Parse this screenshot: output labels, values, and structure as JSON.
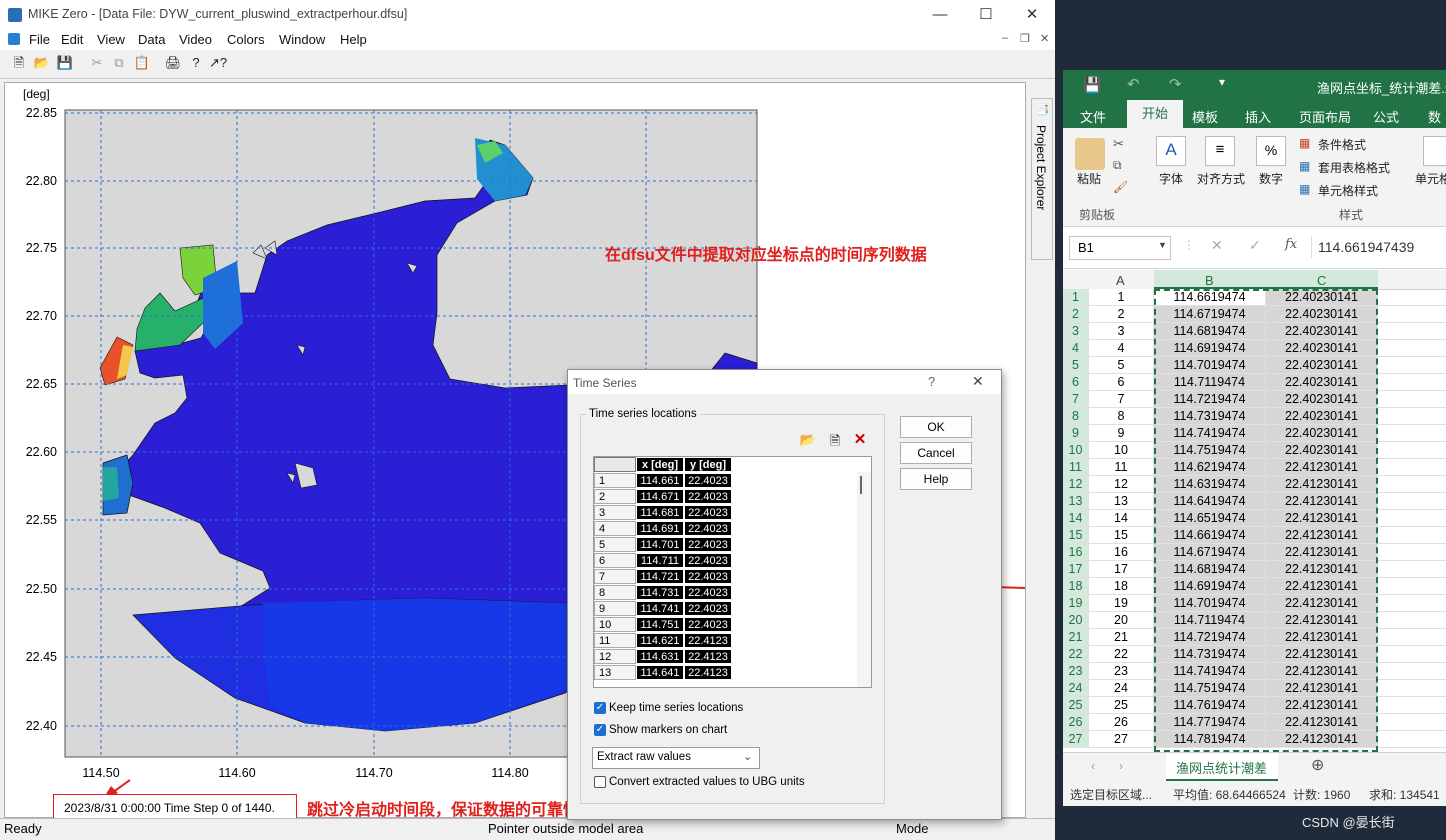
{
  "mike": {
    "title": "MIKE Zero - [Data File: DYW_current_pluswind_extractperhour.dfsu]",
    "menu": [
      "File",
      "Edit",
      "View",
      "Data",
      "Video",
      "Colors",
      "Window",
      "Help"
    ],
    "status_left": "Ready",
    "status_middle": "Pointer outside model area",
    "status_right": "Mode",
    "project_explorer": "Project Explorer",
    "time_step": "2023/8/31 0:00:00  Time Step 0 of 1440."
  },
  "chart": {
    "unit_label": "[deg]",
    "y_ticks": [
      "22.85",
      "22.80",
      "22.75",
      "22.70",
      "22.65",
      "22.60",
      "22.55",
      "22.50",
      "22.45",
      "22.40"
    ],
    "x_ticks": [
      "114.50",
      "114.60",
      "114.70",
      "114.80"
    ]
  },
  "annotations": {
    "top_note": "在dfsu文件中提取对应坐标点的时间序列数据",
    "bottom_note": "跳过冷启动时间段，保证数据的可靠性"
  },
  "dialog": {
    "title": "Time Series",
    "help_q": "?",
    "group_label": "Time series locations",
    "col_x": "x [deg]",
    "col_y": "y [deg]",
    "rows": [
      {
        "n": "1",
        "x": "114.661",
        "y": "22.4023"
      },
      {
        "n": "2",
        "x": "114.671",
        "y": "22.4023"
      },
      {
        "n": "3",
        "x": "114.681",
        "y": "22.4023"
      },
      {
        "n": "4",
        "x": "114.691",
        "y": "22.4023"
      },
      {
        "n": "5",
        "x": "114.701",
        "y": "22.4023"
      },
      {
        "n": "6",
        "x": "114.711",
        "y": "22.4023"
      },
      {
        "n": "7",
        "x": "114.721",
        "y": "22.4023"
      },
      {
        "n": "8",
        "x": "114.731",
        "y": "22.4023"
      },
      {
        "n": "9",
        "x": "114.741",
        "y": "22.4023"
      },
      {
        "n": "10",
        "x": "114.751",
        "y": "22.4023"
      },
      {
        "n": "11",
        "x": "114.621",
        "y": "22.4123"
      },
      {
        "n": "12",
        "x": "114.631",
        "y": "22.4123"
      },
      {
        "n": "13",
        "x": "114.641",
        "y": "22.4123"
      }
    ],
    "ok": "OK",
    "cancel": "Cancel",
    "help": "Help",
    "keep_locations": "Keep time series locations",
    "show_markers": "Show markers on chart",
    "extract_select": "Extract raw values",
    "convert_ubg": "Convert extracted values to UBG units"
  },
  "excel": {
    "title": "渔网点坐标_统计潮差.xlsx",
    "tabs": [
      "文件",
      "开始",
      "模板",
      "插入",
      "页面布局",
      "公式",
      "数据"
    ],
    "paste": "粘贴",
    "font": "字体",
    "align": "对齐方式",
    "number": "数字",
    "clipboard": "剪贴板",
    "cond_fmt": "条件格式",
    "table_fmt": "套用表格格式",
    "cell_style": "单元格样式",
    "styles": "样式",
    "cells": "单元格",
    "name_box": "B1",
    "formula": "114.661947439",
    "fx": "fx",
    "columns": [
      "A",
      "B",
      "C"
    ],
    "rows": [
      [
        "1",
        "114.6619474",
        "22.40230141"
      ],
      [
        "2",
        "114.6719474",
        "22.40230141"
      ],
      [
        "3",
        "114.6819474",
        "22.40230141"
      ],
      [
        "4",
        "114.6919474",
        "22.40230141"
      ],
      [
        "5",
        "114.7019474",
        "22.40230141"
      ],
      [
        "6",
        "114.7119474",
        "22.40230141"
      ],
      [
        "7",
        "114.7219474",
        "22.40230141"
      ],
      [
        "8",
        "114.7319474",
        "22.40230141"
      ],
      [
        "9",
        "114.7419474",
        "22.40230141"
      ],
      [
        "10",
        "114.7519474",
        "22.40230141"
      ],
      [
        "11",
        "114.6219474",
        "22.41230141"
      ],
      [
        "12",
        "114.6319474",
        "22.41230141"
      ],
      [
        "13",
        "114.6419474",
        "22.41230141"
      ],
      [
        "14",
        "114.6519474",
        "22.41230141"
      ],
      [
        "15",
        "114.6619474",
        "22.41230141"
      ],
      [
        "16",
        "114.6719474",
        "22.41230141"
      ],
      [
        "17",
        "114.6819474",
        "22.41230141"
      ],
      [
        "18",
        "114.6919474",
        "22.41230141"
      ],
      [
        "19",
        "114.7019474",
        "22.41230141"
      ],
      [
        "20",
        "114.7119474",
        "22.41230141"
      ],
      [
        "21",
        "114.7219474",
        "22.41230141"
      ],
      [
        "22",
        "114.7319474",
        "22.41230141"
      ],
      [
        "23",
        "114.7419474",
        "22.41230141"
      ],
      [
        "24",
        "114.7519474",
        "22.41230141"
      ],
      [
        "25",
        "114.7619474",
        "22.41230141"
      ],
      [
        "26",
        "114.7719474",
        "22.41230141"
      ],
      [
        "27",
        "114.7819474",
        "22.41230141"
      ]
    ],
    "sheet_tab": "渔网点统计潮差",
    "status_select": "选定目标区域...",
    "status_avg": "平均值: 68.64466524",
    "status_count": "计数: 1960",
    "status_sum": "求和: 134541"
  },
  "watermark": "CSDN @晏长街"
}
